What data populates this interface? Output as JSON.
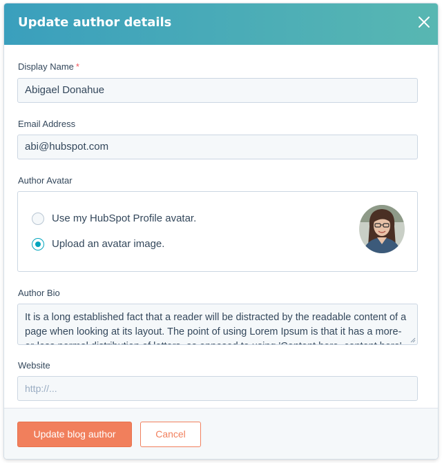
{
  "dialog": {
    "title": "Update author details"
  },
  "fields": {
    "display_name": {
      "label": "Display Name",
      "required_mark": "*",
      "value": "Abigael Donahue"
    },
    "email": {
      "label": "Email Address",
      "value": "abi@hubspot.com"
    },
    "avatar": {
      "label": "Author Avatar",
      "options": [
        {
          "label": "Use my HubSpot Profile avatar.",
          "selected": false
        },
        {
          "label": "Upload an avatar image.",
          "selected": true
        }
      ]
    },
    "bio": {
      "label": "Author Bio",
      "value": "It is a long established fact that a reader will be distracted by the readable content of a page when looking at its layout. The point of using Lorem Ipsum is that it has a more-or-less normal distribution of letters, as opposed to using 'Content here, content here', making it look like readable English."
    },
    "website": {
      "label": "Website",
      "placeholder": "http://..."
    }
  },
  "footer": {
    "primary_label": "Update blog author",
    "secondary_label": "Cancel"
  },
  "icons": {
    "close": "close-icon",
    "radio": "radio-icon",
    "avatar": "avatar-photo"
  },
  "colors": {
    "header_start": "#3a9fbd",
    "header_end": "#58b7b2",
    "accent": "#00a4bd",
    "primary": "#f17f5c",
    "required": "#f2545b"
  }
}
